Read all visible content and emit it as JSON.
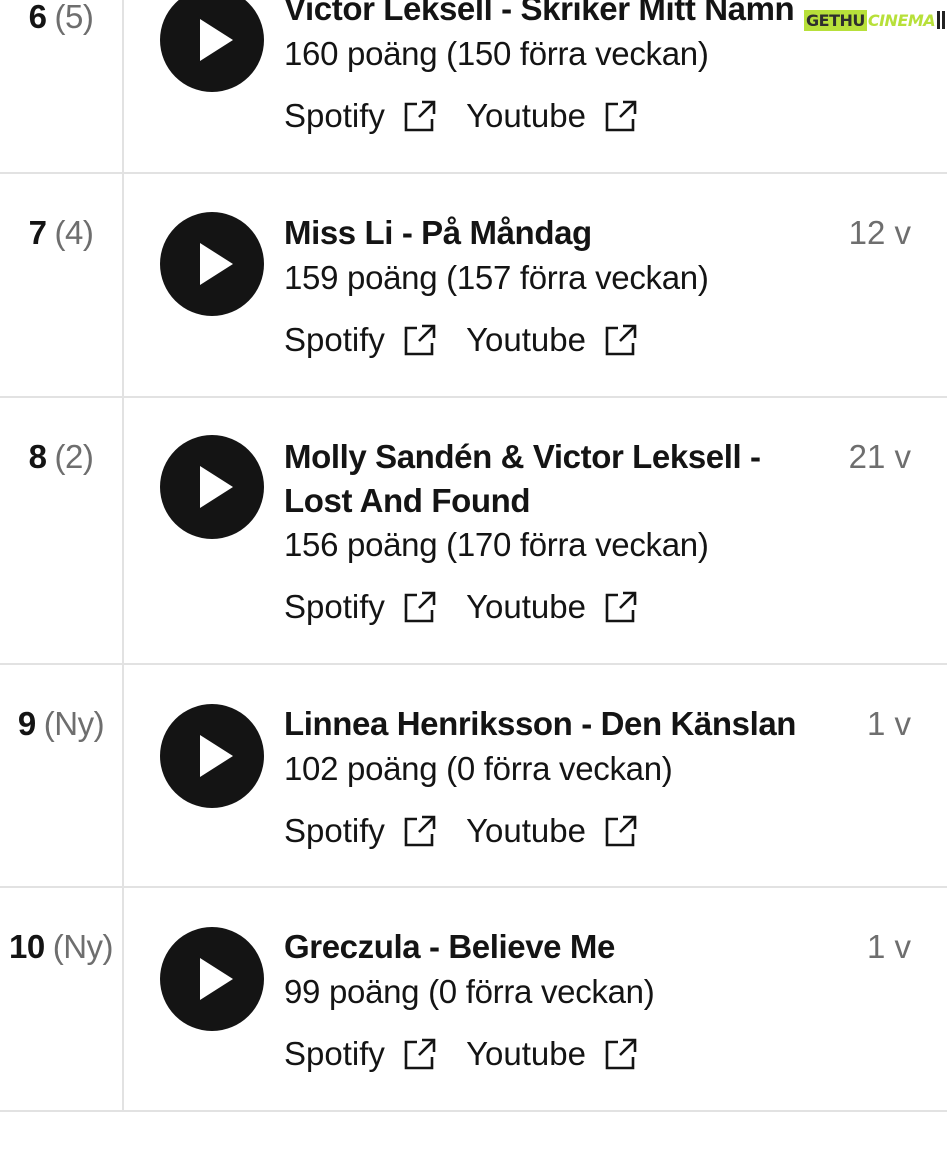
{
  "chart": {
    "rows": [
      {
        "rank": "6",
        "previous_rank": "(5)",
        "title": "Victor Leksell - Skriker Mitt Namn",
        "weeks": "",
        "points": "160 poäng (150 förra veckan)",
        "spotify_label": "Spotify",
        "youtube_label": "Youtube"
      },
      {
        "rank": "7",
        "previous_rank": "(4)",
        "title": "Miss Li - På Måndag",
        "weeks": "12 v",
        "points": "159 poäng (157 förra veckan)",
        "spotify_label": "Spotify",
        "youtube_label": "Youtube"
      },
      {
        "rank": "8",
        "previous_rank": "(2)",
        "title": "Molly Sandén & Victor Leksell - Lost And Found",
        "weeks": "21 v",
        "points": "156 poäng (170 förra veckan)",
        "spotify_label": "Spotify",
        "youtube_label": "Youtube"
      },
      {
        "rank": "9",
        "previous_rank": "(Ny)",
        "title": "Linnea Henriksson - Den Känslan",
        "weeks": "1 v",
        "points": "102 poäng (0 förra veckan)",
        "spotify_label": "Spotify",
        "youtube_label": "Youtube"
      },
      {
        "rank": "10",
        "previous_rank": "(Ny)",
        "title": "Greczula - Believe Me",
        "weeks": "1 v",
        "points": "99 poäng (0 förra veckan)",
        "spotify_label": "Spotify",
        "youtube_label": "Youtube"
      }
    ]
  },
  "icons": {
    "play": "play-icon",
    "external_link": "external-link-icon"
  },
  "watermark": {
    "part1": "GETHU",
    "part2": "CINEMA"
  },
  "colors": {
    "text": "#141414",
    "muted": "#6e6e6e",
    "divider": "#e2e2e2",
    "play_bg": "#141414",
    "watermark_accent": "#b7e03a"
  }
}
